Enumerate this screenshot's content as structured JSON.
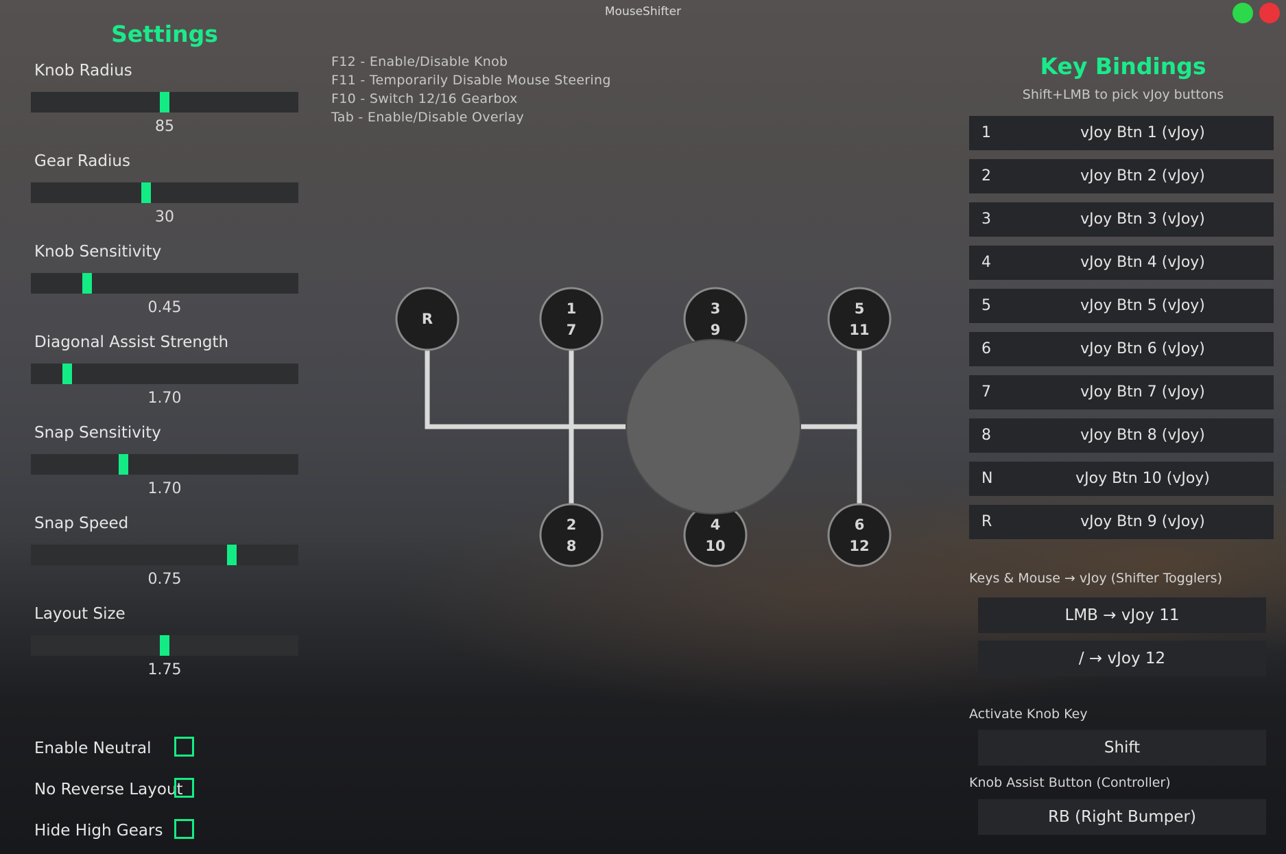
{
  "window": {
    "title": "MouseShifter",
    "controls": {
      "green_color": "#2bd94a",
      "red_color": "#e8343a"
    }
  },
  "settings": {
    "title": "Settings",
    "sliders": [
      {
        "label": "Knob Radius",
        "value": "85",
        "position_fraction": 0.5
      },
      {
        "label": "Gear Radius",
        "value": "30",
        "position_fraction": 0.43
      },
      {
        "label": "Knob Sensitivity",
        "value": "0.45",
        "position_fraction": 0.21
      },
      {
        "label": "Diagonal Assist Strength",
        "value": "1.70",
        "position_fraction": 0.135
      },
      {
        "label": "Snap Sensitivity",
        "value": "1.70",
        "position_fraction": 0.345
      },
      {
        "label": "Snap Speed",
        "value": "0.75",
        "position_fraction": 0.75
      },
      {
        "label": "Layout Size",
        "value": "1.75",
        "position_fraction": 0.5
      }
    ],
    "checkboxes": [
      {
        "label": "Enable Neutral",
        "checked": false
      },
      {
        "label": "No Reverse Layout",
        "checked": false
      },
      {
        "label": "Hide High Gears",
        "checked": false
      }
    ]
  },
  "hotkeys": [
    "F12 - Enable/Disable Knob",
    "F11 - Temporarily Disable Mouse Steering",
    "F10 - Switch 12/16 Gearbox",
    "Tab - Enable/Disable Overlay"
  ],
  "shifter": {
    "gears": [
      {
        "top": "R",
        "bottom": ""
      },
      {
        "top": "1",
        "bottom": "7"
      },
      {
        "top": "3",
        "bottom": "9"
      },
      {
        "top": "5",
        "bottom": "11"
      },
      {
        "top": "2",
        "bottom": "8"
      },
      {
        "top": "4",
        "bottom": "10"
      },
      {
        "top": "6",
        "bottom": "12"
      }
    ],
    "colors": {
      "gear_fill": "#1e1e1f",
      "gear_ring": "#8a8a8a",
      "knob": "#5f5f5f",
      "line": "#d9d9d9"
    }
  },
  "key_bindings": {
    "title": "Key Bindings",
    "subtitle": "Shift+LMB to pick vJoy buttons",
    "rows": [
      {
        "key": "1",
        "value": "vJoy Btn 1 (vJoy)"
      },
      {
        "key": "2",
        "value": "vJoy Btn 2 (vJoy)"
      },
      {
        "key": "3",
        "value": "vJoy Btn 3 (vJoy)"
      },
      {
        "key": "4",
        "value": "vJoy Btn 4 (vJoy)"
      },
      {
        "key": "5",
        "value": "vJoy Btn 5 (vJoy)"
      },
      {
        "key": "6",
        "value": "vJoy Btn 6 (vJoy)"
      },
      {
        "key": "7",
        "value": "vJoy Btn 7 (vJoy)"
      },
      {
        "key": "8",
        "value": "vJoy Btn 8 (vJoy)"
      },
      {
        "key": "N",
        "value": "vJoy Btn 10 (vJoy)"
      },
      {
        "key": "R",
        "value": "vJoy Btn 9 (vJoy)"
      }
    ],
    "togglers_label": "Keys & Mouse → vJoy (Shifter Togglers)",
    "togglers": [
      "LMB → vJoy 11",
      "/ → vJoy 12"
    ],
    "activate_label": "Activate Knob Key",
    "activate_value": "Shift",
    "assist_label": "Knob Assist Button (Controller)",
    "assist_value": "RB (Right Bumper)"
  },
  "accent_color": "#13ec84"
}
